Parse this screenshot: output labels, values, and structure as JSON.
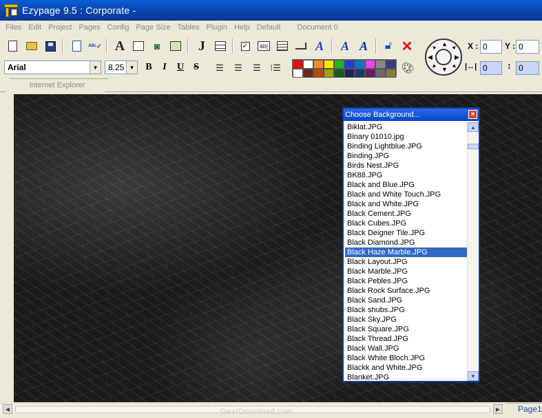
{
  "window": {
    "title": "Ezypage 9.5 : Corporate -"
  },
  "menu": {
    "items": [
      "Files",
      "Edit",
      "Project",
      "Pages",
      "Config",
      "Page Size",
      "Tables",
      "Plugin",
      "Help",
      "Default"
    ],
    "document_label": "Document 0"
  },
  "formatting": {
    "font": "Arial",
    "size": "8.25",
    "bold": "B",
    "italic": "I",
    "underline": "U",
    "strike": "S"
  },
  "palette": [
    "#ff0000",
    "#ffffff",
    "#ff8c1a",
    "#ffe600",
    "#20b820",
    "#1e3fd0",
    "#0a78c8",
    "#ff40ff",
    "#8a8a8a",
    "#3a3a8a",
    "#ffffff",
    "#6a2a1a",
    "#b84a00",
    "#a0a000",
    "#1a5a1a",
    "#20205a",
    "#1a3a6a",
    "#6a1a6a",
    "#6a6a6a",
    "#8a7a3a"
  ],
  "position": {
    "x_label": "X :",
    "x_value": "0",
    "y_label": "Y :",
    "y_value": "0",
    "width_value": "0",
    "height_value": "0"
  },
  "tabs": [
    "Internet Explorer"
  ],
  "dialog": {
    "title": "Choose Background...",
    "close": "×",
    "items": [
      "Biklat.JPG",
      "Binary 01010.jpg",
      "Binding Lightblue.JPG",
      "Binding.JPG",
      "Birds Nest.JPG",
      "BK88.JPG",
      "Black and Blue.JPG",
      "Black and White Touch.JPG",
      "Black and White.JPG",
      "Black Cement.JPG",
      "Black Cubes.JPG",
      "Black Deigner Tile.JPG",
      "Black Diamond.JPG",
      "Black Haze Marble.JPG",
      "Black Layout.JPG",
      "Black Marble.JPG",
      "Black Pebles.JPG",
      "Black Rock Surface.JPG",
      "Black Sand.JPG",
      "Black shubs.JPG",
      "Black Sky.JPG",
      "Black Square.JPG",
      "Black Thread.JPG",
      "Black Wall.JPG",
      "Black White Bloch.JPG",
      "Blackk and White.JPG",
      "Blanket.JPG"
    ],
    "selected_index": 13
  },
  "status": {
    "page_label": "Page1",
    "watermark": "GearDownload.com"
  },
  "colors": {
    "titlebar": "#0a4cc0",
    "selection": "#316ac5",
    "canvas": "#1a1a1a"
  }
}
